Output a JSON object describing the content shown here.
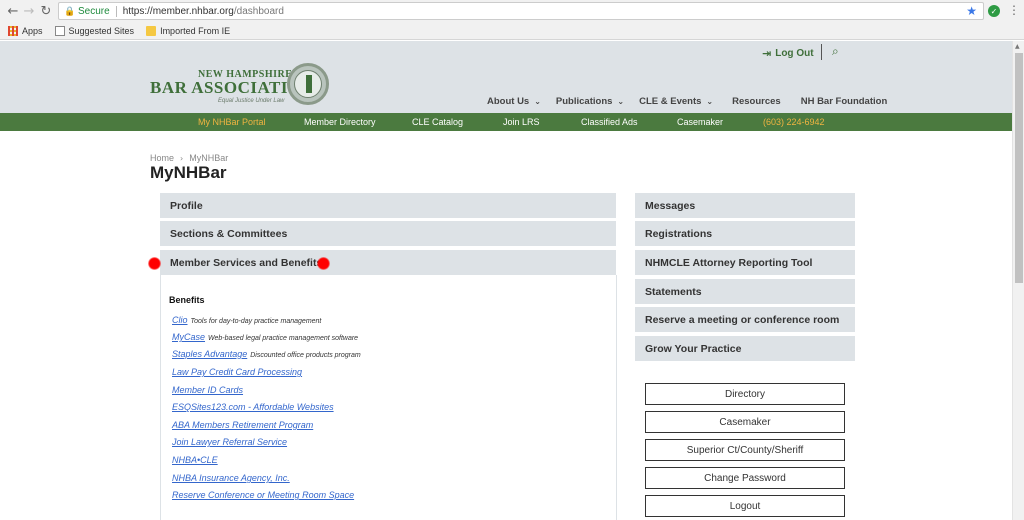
{
  "browser": {
    "secure_label": "Secure",
    "url_host": "https://member.nhbar.org",
    "url_path": "/dashboard",
    "bookmarks": [
      "Apps",
      "Suggested Sites",
      "Imported From IE"
    ]
  },
  "header": {
    "logo_line1": "NEW HAMPSHIRE",
    "logo_line2": "BAR ASSOCIATION",
    "logo_tagline": "Equal Justice Under Law",
    "logout_label": "Log Out",
    "main_nav": [
      {
        "label": "About Us",
        "has_dropdown": true
      },
      {
        "label": "Publications",
        "has_dropdown": true
      },
      {
        "label": "CLE & Events",
        "has_dropdown": true
      },
      {
        "label": "Resources",
        "has_dropdown": false
      },
      {
        "label": "NH Bar Foundation",
        "has_dropdown": false
      }
    ]
  },
  "green_nav": {
    "items": [
      "My NHBar Portal",
      "Member Directory",
      "CLE Catalog",
      "Join LRS",
      "Classified Ads",
      "Casemaker"
    ],
    "phone": "(603) 224-6942",
    "active_index": 0
  },
  "breadcrumb": {
    "home": "Home",
    "current": "MyNHBar"
  },
  "page_title": "MyNHBar",
  "left_panels": [
    "Profile",
    "Sections & Committees",
    "Member Services and Benefits"
  ],
  "benefits": {
    "heading": "Benefits",
    "items": [
      {
        "link": "Clio",
        "desc": "Tools for day-to-day practice management"
      },
      {
        "link": "MyCase",
        "desc": "Web-based legal practice management software"
      },
      {
        "link": "Staples Advantage",
        "desc": "Discounted office products program"
      },
      {
        "link": "Law Pay Credit Card Processing",
        "desc": ""
      },
      {
        "link": "Member ID Cards",
        "desc": ""
      },
      {
        "link": "ESQSites123.com - Affordable Websites",
        "desc": ""
      },
      {
        "link": "ABA Members Retirement Program",
        "desc": ""
      },
      {
        "link": "Join Lawyer Referral Service",
        "desc": ""
      },
      {
        "link": "NHBA•CLE",
        "desc": ""
      },
      {
        "link": "NHBA Insurance Agency, Inc.",
        "desc": ""
      },
      {
        "link": "Reserve Conference or Meeting Room Space",
        "desc": ""
      }
    ]
  },
  "right_panels": [
    "Messages",
    "Registrations",
    "NHMCLE Attorney Reporting Tool",
    "Statements",
    "Reserve a meeting or conference room",
    "Grow Your Practice"
  ],
  "action_buttons": [
    "Directory",
    "Casemaker",
    "Superior Ct/County/Sheriff",
    "Change Password",
    "Logout"
  ],
  "colors": {
    "brand_green": "#4b7a3f",
    "highlight_orange": "#f0b441",
    "panel_gray": "#dde2e6",
    "link_blue": "#3366cc"
  }
}
